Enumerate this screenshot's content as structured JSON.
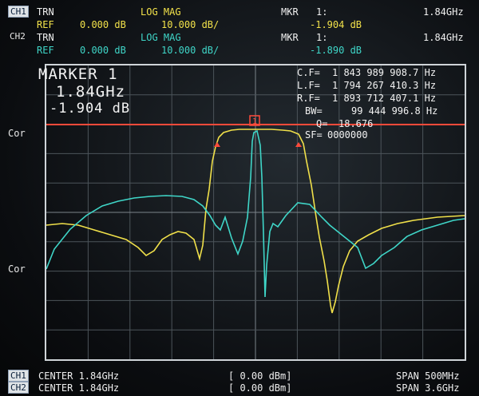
{
  "header": {
    "ch1": {
      "channel": "CH1",
      "format": "TRN",
      "ref_label": "REF",
      "ref_value": "0.000 dB",
      "meas": "LOG MAG",
      "scale": "10.000 dB/",
      "mkr_label": "MKR",
      "mkr_num": "1:",
      "mkr_value": "-1.904 dB",
      "mkr_freq": "1.84GHz"
    },
    "ch2": {
      "channel": "CH2",
      "format": "TRN",
      "ref_label": "REF",
      "ref_value": "0.000 dB",
      "meas": "LOG MAG",
      "scale": "10.000 dB/",
      "mkr_label": "MKR",
      "mkr_num": "1:",
      "mkr_value": "-1.890 dB",
      "mkr_freq": "1.84GHz"
    }
  },
  "marker_readout": {
    "title": "MARKER  1",
    "freq": "1.84GHz",
    "value": "-1.904 dB"
  },
  "filter_params": {
    "cf_label": "C.F=",
    "cf_value": "1 843 989 908.7 Hz",
    "lf_label": "L.F=",
    "lf_value": "1 794 267 410.3 Hz",
    "rf_label": "R.F=",
    "rf_value": "1 893 712 407.1 Hz",
    "bw_label": "BW=",
    "bw_value": "99 444 996.8 Hz",
    "q_label": "Q=",
    "q_value": "18.676",
    "sf_label": "SF=",
    "sf_value": "0000000"
  },
  "side_labels": {
    "top": "Cor",
    "bottom": "Cor"
  },
  "marker_flag": "1",
  "footer": {
    "ch1": {
      "channel": "CH1",
      "center": "CENTER 1.84GHz",
      "power": "[ 0.00 dBm]",
      "span": "SPAN 500MHz"
    },
    "ch2": {
      "channel": "CH2",
      "center": "CENTER 1.84GHz",
      "power": "[ 0.00 dBm]",
      "span": "SPAN 3.6GHz"
    }
  },
  "colors": {
    "ch1_trace": "#f0e04a",
    "ch2_trace": "#3fd6c8",
    "marker_line": "#ff4a3a"
  }
}
